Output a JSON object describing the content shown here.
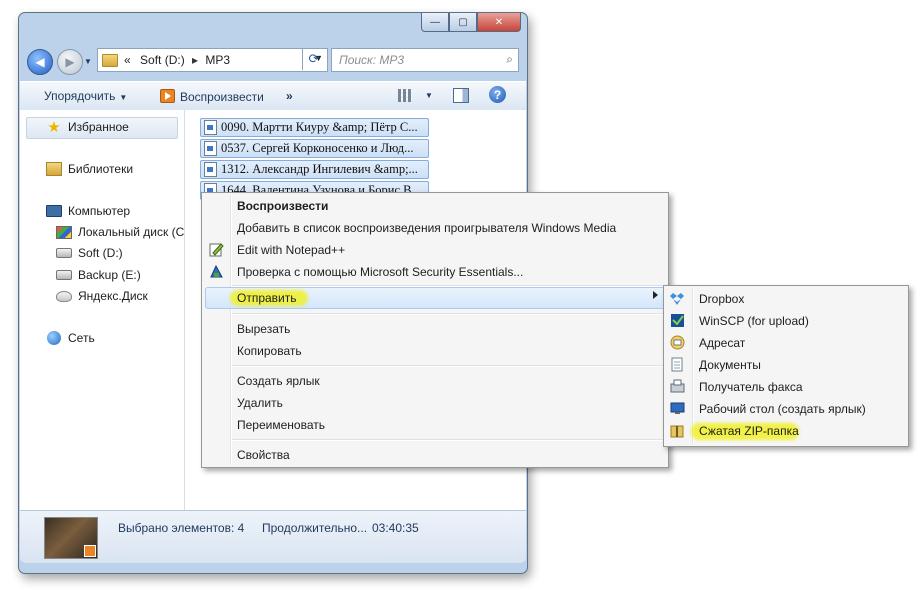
{
  "window": {
    "controls": {
      "minimize": "—",
      "maximize": "▢",
      "close": "✕"
    }
  },
  "address": {
    "prefix": "«",
    "drive": "Soft (D:)",
    "separator": "▸",
    "folder": "MP3",
    "search_placeholder": "Поиск: MP3"
  },
  "toolbar": {
    "organize": "Упорядочить",
    "play": "Воспроизвести",
    "more": "»"
  },
  "nav": {
    "favorites": "Избранное",
    "libraries": "Библиотеки",
    "computer": "Компьютер",
    "local_disk": "Локальный диск (C",
    "soft": "Soft (D:)",
    "backup": "Backup (E:)",
    "yandex": "Яндекс.Диск",
    "network": "Сеть"
  },
  "files": [
    "0090. Мартти Киуру  &amp; Пётр С...",
    "0537. Сергей Корконосенко и Люд...",
    "1312. Александр Ингилевич &amp;...",
    "1644. Валентина Узунова и Борис В..."
  ],
  "status": {
    "selected": "Выбрано элементов: 4",
    "duration_label": "Продолжительно...",
    "duration_value": "03:40:35"
  },
  "context_menu": {
    "play": "Воспроизвести",
    "add_wmp": "Добавить в список воспроизведения проигрывателя Windows Media",
    "notepad": "Edit with Notepad++",
    "mse": "Проверка с помощью Microsoft Security Essentials...",
    "send_to": "Отправить",
    "cut": "Вырезать",
    "copy": "Копировать",
    "shortcut": "Создать ярлык",
    "delete": "Удалить",
    "rename": "Переименовать",
    "properties": "Свойства"
  },
  "send_to_menu": {
    "dropbox": "Dropbox",
    "winscp": "WinSCP (for upload)",
    "recipient": "Адресат",
    "documents": "Документы",
    "fax": "Получатель факса",
    "desktop": "Рабочий стол (создать ярлык)",
    "zip": "Сжатая ZIP-папка"
  },
  "colors": {
    "highlight_marker": "#f0f028",
    "window_frame": "#bcd2ea",
    "selection": "#cde0f6"
  }
}
